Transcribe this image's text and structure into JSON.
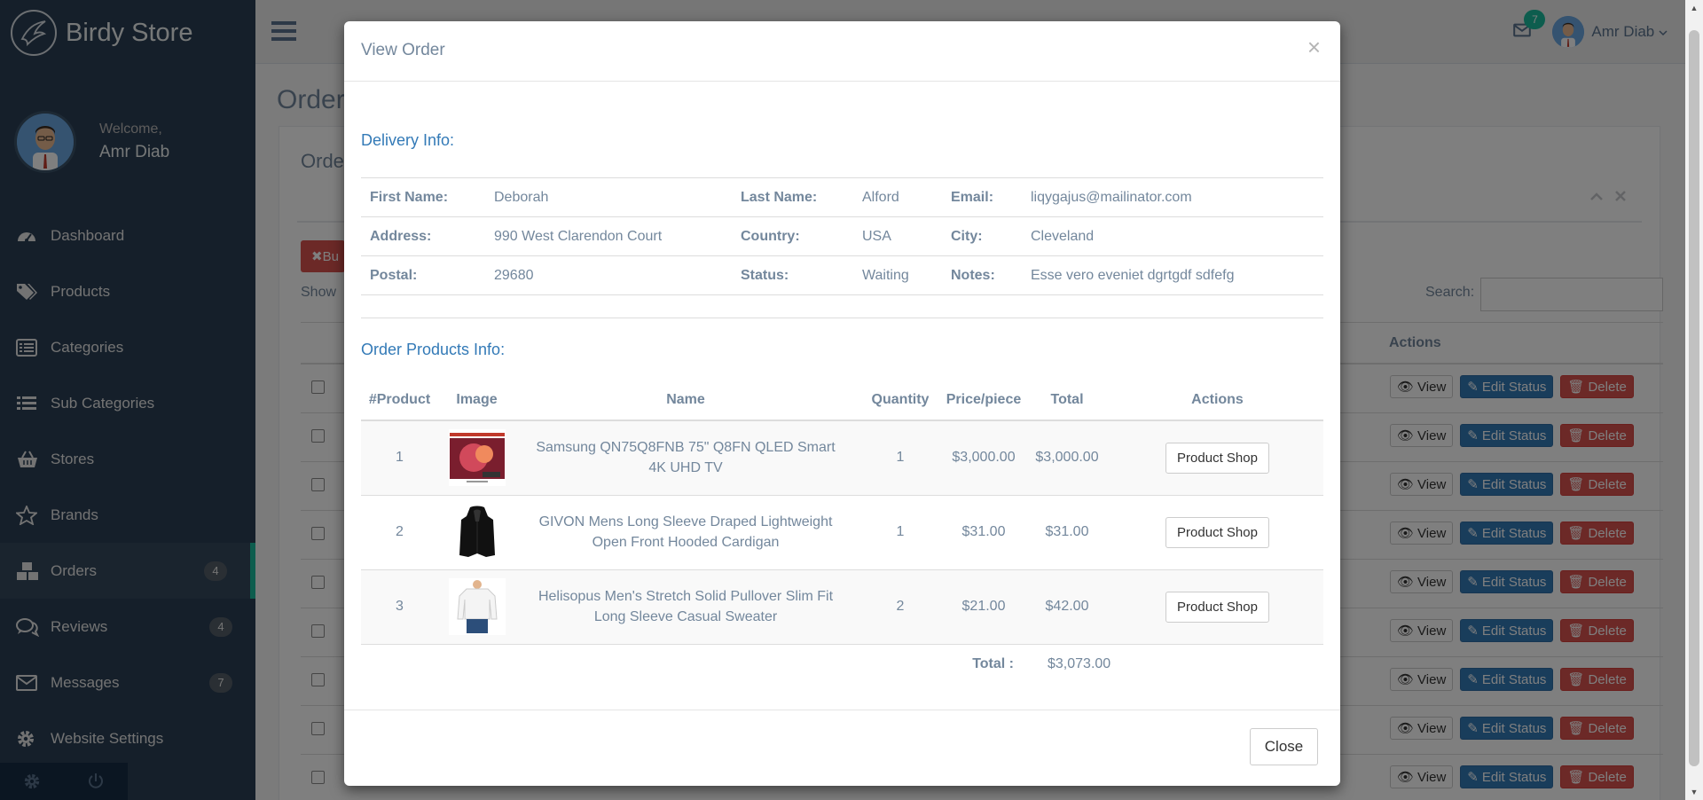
{
  "brand": {
    "title": "Birdy Store"
  },
  "profile": {
    "welcome": "Welcome,",
    "name": "Amr Diab"
  },
  "sidebar": {
    "items": [
      {
        "label": "Dashboard",
        "icon": "dashboard-icon",
        "badge": ""
      },
      {
        "label": "Products",
        "icon": "tags-icon",
        "badge": ""
      },
      {
        "label": "Categories",
        "icon": "list-alt-icon",
        "badge": ""
      },
      {
        "label": "Sub Categories",
        "icon": "list-icon",
        "badge": ""
      },
      {
        "label": "Stores",
        "icon": "basket-icon",
        "badge": ""
      },
      {
        "label": "Brands",
        "icon": "star-icon",
        "badge": ""
      },
      {
        "label": "Orders",
        "icon": "cubes-icon",
        "badge": "4",
        "active": true
      },
      {
        "label": "Reviews",
        "icon": "comments-icon",
        "badge": "4"
      },
      {
        "label": "Messages",
        "icon": "envelope-icon",
        "badge": "7"
      },
      {
        "label": "Website Settings",
        "icon": "gear-icon",
        "badge": ""
      }
    ]
  },
  "topbar": {
    "mail_badge": "7",
    "user_name": "Amr Diab"
  },
  "page": {
    "title": "Order",
    "panel_title": "Orde",
    "bulk_label": "Bu",
    "show_label": "Show",
    "search_label": "Search:",
    "actions_header": "Actions",
    "row_buttons": {
      "view": "View",
      "edit": "Edit Status",
      "delete": "Delete"
    },
    "row_count": 9
  },
  "modal": {
    "title": "View Order",
    "delivery_title": "Delivery Info:",
    "products_title": "Order Products Info:",
    "delivery": {
      "first_name_label": "First Name:",
      "first_name": "Deborah",
      "last_name_label": "Last Name:",
      "last_name": "Alford",
      "email_label": "Email:",
      "email": "liqygajus@mailinator.com",
      "address_label": "Address:",
      "address": "990 West Clarendon Court",
      "country_label": "Country:",
      "country": "USA",
      "city_label": "City:",
      "city": "Cleveland",
      "postal_label": "Postal:",
      "postal": "29680",
      "status_label": "Status:",
      "status": "Waiting",
      "notes_label": "Notes:",
      "notes": "Esse vero eveniet dgrtgdf sdfefg"
    },
    "columns": [
      "#Product",
      "Image",
      "Name",
      "Quantity",
      "Price/piece",
      "Total",
      "Actions"
    ],
    "products": [
      {
        "num": "1",
        "name": "Samsung QN75Q8FNB 75\" Q8FN QLED Smart 4K UHD TV",
        "qty": "1",
        "price": "$3,000.00",
        "total": "$3,000.00",
        "action": "Product Shop"
      },
      {
        "num": "2",
        "name": "GIVON Mens Long Sleeve Draped Lightweight Open Front Hooded Cardigan",
        "qty": "1",
        "price": "$31.00",
        "total": "$31.00",
        "action": "Product Shop"
      },
      {
        "num": "3",
        "name": "Helisopus Men's Stretch Solid Pullover Slim Fit Long Sleeve Casual Sweater",
        "qty": "2",
        "price": "$21.00",
        "total": "$42.00",
        "action": "Product Shop"
      }
    ],
    "total_label": "Total :",
    "total_value": "$3,073.00",
    "close_label": "Close",
    "close_x": "×"
  },
  "colors": {
    "sidebar": "#2a3f54",
    "accent": "#1abb9c",
    "link": "#337ab7",
    "danger": "#d9534f"
  }
}
